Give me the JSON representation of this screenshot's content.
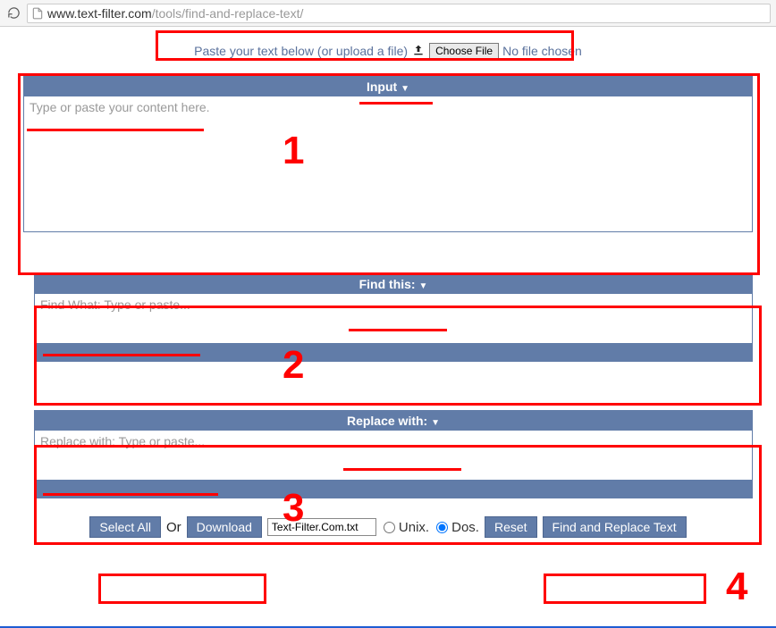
{
  "browser": {
    "url_domain": "www.text-filter.com",
    "url_path": "/tools/find-and-replace-text/"
  },
  "upload": {
    "prompt": "Paste your text below (or upload a file)",
    "choose_file_label": "Choose File",
    "no_file_label": "No file chosen"
  },
  "panels": {
    "input": {
      "title": "Input",
      "arrow": "▼",
      "placeholder": "Type or paste your content here."
    },
    "find": {
      "title": "Find this:",
      "arrow": "▼",
      "placeholder": "Find What: Type or paste..."
    },
    "replace": {
      "title": "Replace with:",
      "arrow": "▼",
      "placeholder": "Replace with: Type or paste..."
    }
  },
  "controls": {
    "select_all": "Select All",
    "or": "Or",
    "download": "Download",
    "filename_value": "Text-Filter.Com.txt",
    "unix_label": "Unix.",
    "dos_label": "Dos.",
    "line_ending_selected": "dos",
    "reset": "Reset",
    "find_replace": "Find and Replace Text"
  },
  "annotations": {
    "n1": "1",
    "n2": "2",
    "n3": "3",
    "n4": "4"
  }
}
